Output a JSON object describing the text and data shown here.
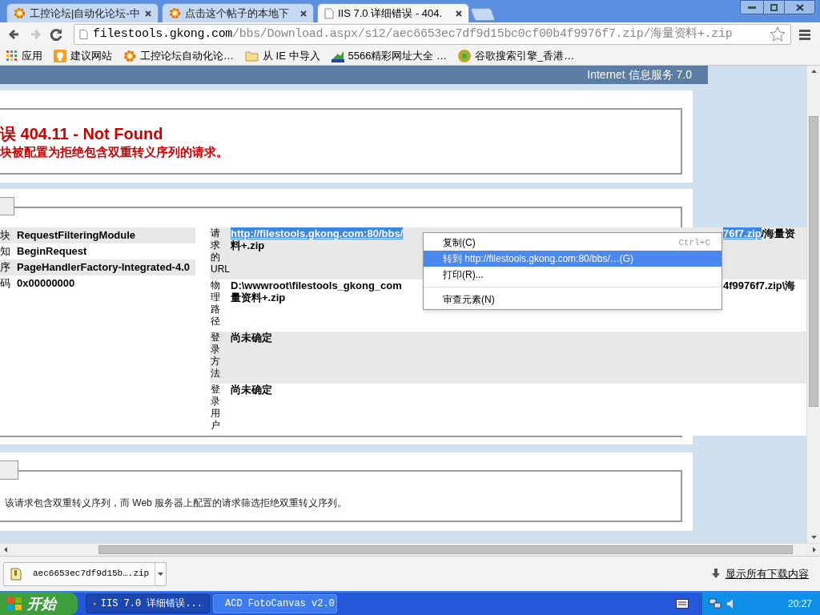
{
  "browser_tabs": [
    {
      "title": "工控论坛|自动化论坛-中",
      "selected": false
    },
    {
      "title": "点击这个帖子的本地下",
      "selected": false
    },
    {
      "title": "IIS 7.0 详细错误 - 404.",
      "selected": true
    }
  ],
  "nav_buttons": [
    {
      "kind": "back",
      "disabled": false
    },
    {
      "kind": "forward",
      "disabled": true
    },
    {
      "kind": "reload",
      "disabled": false
    }
  ],
  "address_bar": {
    "host": "filestools.gkong.com",
    "path": "/bbs/Download.aspx/s12/aec6653ec7df9d15bc0cf00b4f9976f7.zip/海量资料+.zip"
  },
  "bookmarks": [
    {
      "kind": "apps",
      "label": "应用"
    },
    {
      "kind": "bulb",
      "label": "建议网站"
    },
    {
      "kind": "gear",
      "label": "工控论坛自动化论…"
    },
    {
      "kind": "folder",
      "label": "从 IE 中导入"
    },
    {
      "kind": "chart",
      "label": "5566精彩网址大全 …"
    },
    {
      "kind": "globe",
      "label": "谷歌搜索引擎_香港…"
    }
  ],
  "page": {
    "banner": "Internet 信息服务 7.0",
    "error_title": "误 404.11 - Not Found",
    "error_subtitle": "块被配置为拒绝包含双重转义序列的请求。",
    "details_left": [
      {
        "label": "块",
        "value": "RequestFilteringModule"
      },
      {
        "label": "知",
        "value": "BeginRequest"
      },
      {
        "label": "序",
        "value": "PageHandlerFactory-Integrated-4.0"
      },
      {
        "label": "码",
        "value": "0x00000000"
      }
    ],
    "details_right": [
      {
        "label": "请求的URL",
        "segments": [
          {
            "text": "http://filestools.gkong.com:80/bbs/",
            "selected": true
          },
          {
            "text": "76f7.zip",
            "selected": true
          },
          {
            "text": "/海量资",
            "selected": false
          }
        ],
        "continuation": "料+.zip"
      },
      {
        "label": "物理路径",
        "segments": [
          {
            "text": "D:\\wwwroot\\filestools_gkong_com",
            "selected": false
          },
          {
            "text": "4f9976f7.zip\\海",
            "selected": false
          }
        ],
        "continuation": "量资料+.zip"
      },
      {
        "label": "登录方法",
        "segments": [
          {
            "text": "尚未确定",
            "selected": false
          }
        ]
      },
      {
        "label": "登录用户",
        "segments": [
          {
            "text": "尚未确定",
            "selected": false
          }
        ]
      }
    ],
    "cause": "该请求包含双重转义序列，而 Web 服务器上配置的请求筛选拒绝双重转义序列。"
  },
  "context_menu": {
    "items": [
      {
        "label": "复制(C)",
        "shortcut": "Ctrl+C",
        "selected": false,
        "separator_before": false
      },
      {
        "label": "转到 http://filestools.gkong.com:80/bbs/…(G)",
        "selected": true,
        "separator_before": false
      },
      {
        "label": "打印(R)...",
        "selected": false,
        "separator_before": false
      },
      {
        "label": "审查元素(N)",
        "selected": false,
        "separator_before": true
      }
    ]
  },
  "download_bar": {
    "file": "aec6653ec7df9d15b….zip",
    "show_all": "显示所有下载内容"
  },
  "taskbar": {
    "start": "开始",
    "tasks": [
      {
        "label": "IIS 7.0 详细错误...",
        "kind": "chrome",
        "selected": true
      },
      {
        "label": "ACD FotoCanvas v2.0",
        "kind": "acd",
        "selected": false
      }
    ],
    "clock": "20:27"
  }
}
